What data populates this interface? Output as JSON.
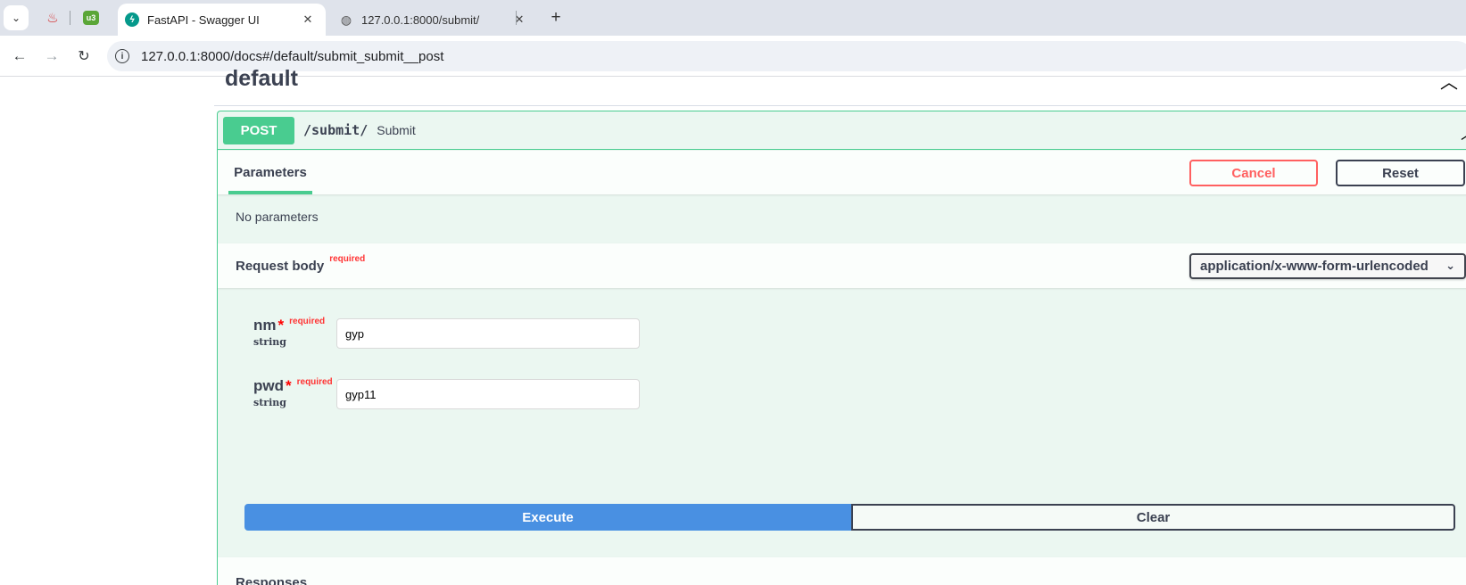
{
  "browser": {
    "menu_icon": "chevron-down-icon",
    "pinned_tabs": [
      {
        "icon": "octopus-logo-icon",
        "glyph": "♨"
      },
      {
        "icon": "u3-logo-icon",
        "glyph": "u3"
      }
    ],
    "tabs": [
      {
        "title": "FastAPI - Swagger UI",
        "favicon": "fastapi-icon",
        "active": true
      },
      {
        "title": "127.0.0.1:8000/submit/",
        "favicon": "globe-icon",
        "active": false
      }
    ],
    "url": "127.0.0.1:8000/docs#/default/submit_submit__post"
  },
  "swagger": {
    "tag": "default",
    "operation": {
      "method": "POST",
      "path": "/submit/",
      "summary": "Submit",
      "color": "#49cc90"
    },
    "parameters": {
      "tab_label": "Parameters",
      "cancel_label": "Cancel",
      "reset_label": "Reset",
      "empty_text": "No parameters"
    },
    "request_body": {
      "title": "Request body",
      "required_label": "required",
      "content_type": "application/x-www-form-urlencoded",
      "fields": [
        {
          "name": "nm",
          "star": "*",
          "required": "required",
          "type": "string",
          "value": "gyp"
        },
        {
          "name": "pwd",
          "star": "*",
          "required": "required",
          "type": "string",
          "value": "gyp11"
        }
      ]
    },
    "execute_label": "Execute",
    "clear_label": "Clear",
    "responses_title": "Responses"
  }
}
